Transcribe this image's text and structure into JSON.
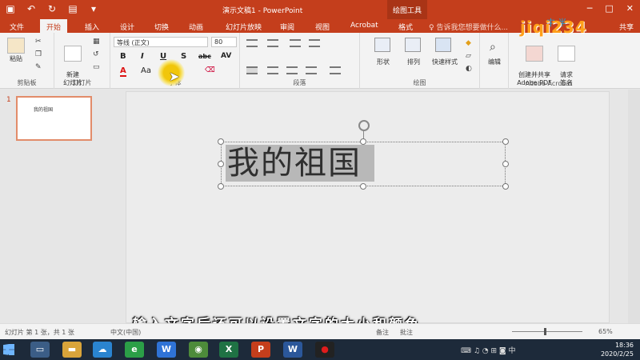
{
  "titlebar": {
    "title": "演示文稿1 - PowerPoint",
    "context_tab": "绘图工具"
  },
  "tabs": [
    {
      "label": "文件"
    },
    {
      "label": "开始"
    },
    {
      "label": "插入"
    },
    {
      "label": "设计"
    },
    {
      "label": "切换"
    },
    {
      "label": "动画"
    },
    {
      "label": "幻灯片放映"
    },
    {
      "label": "审阅"
    },
    {
      "label": "视图"
    },
    {
      "label": "Acrobat"
    },
    {
      "label": "格式"
    }
  ],
  "tell_me": "♀ 告诉我您想要做什么...",
  "share": "共享",
  "ribbon": {
    "paste_label": "粘贴",
    "clipboard_label": "剪贴板",
    "new_slide_label": "新建\n幻灯片",
    "slides_label": "幻灯片",
    "font_name": "等线 (正文)",
    "font_size": "80",
    "bold": "B",
    "italic": "I",
    "underline": "U",
    "shadow": "S",
    "strike": "abc",
    "spacing": "AV",
    "font_color": "A",
    "change_case": "Aa",
    "font_group_label": "字体",
    "paragraph_label": "段落",
    "shape_label": "形状",
    "arrange_label": "排列",
    "quick_style_label": "快速样式",
    "drawing_label": "绘图",
    "edit_label": "编辑",
    "create_pdf_label": "创建并共享\nAdobe PDF",
    "request_sign_label": "请求\n签名",
    "acrobat_label": "Adobe Acrobat"
  },
  "thumbnail": {
    "number": "1",
    "text": "我的祖国"
  },
  "slide": {
    "text": "我的祖国"
  },
  "subtitle": "输入文字后还可以设置文字的大小和颜色",
  "status": {
    "slide_info": "幻灯片 第 1 张，共 1 张",
    "language": "中文(中国)",
    "notes": "备注",
    "comments": "批注",
    "zoom": "65%"
  },
  "taskbar": {
    "time": "18:36",
    "date": "2020/2/25",
    "ime": "中"
  },
  "watermark": {
    "top": "中·半",
    "text": "jiqi234"
  },
  "colors": {
    "accent": "#c43e1c",
    "highlight": "#b8b8b8"
  }
}
